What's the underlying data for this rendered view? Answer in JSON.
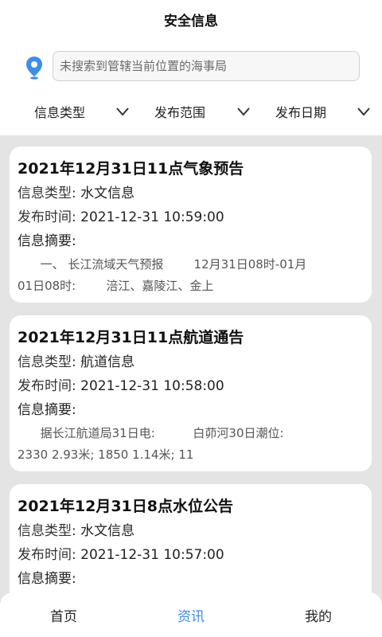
{
  "header": {
    "title": "安全信息"
  },
  "search": {
    "placeholder": "未搜索到管辖当前位置的海事局"
  },
  "colors": {
    "accent": "#3b8eea",
    "list_bg": "#e4e4e4"
  },
  "filters": [
    {
      "label": "信息类型"
    },
    {
      "label": "发布范围"
    },
    {
      "label": "发布日期"
    }
  ],
  "labels": {
    "type": "信息类型:",
    "time": "发布时间:",
    "summary": "信息摘要:"
  },
  "cards": [
    {
      "title": "2021年12月31日11点气象预告",
      "type": "水文信息",
      "time": "2021-12-31 10:59:00",
      "summary_line1": "      一、 长江流域天气预报        12月31日08时-01月",
      "summary_line2": "01日08时:        涪江、嘉陵江、金上"
    },
    {
      "title": "2021年12月31日11点航道通告",
      "type": "航道信息",
      "time": "2021-12-31 10:58:00",
      "summary_line1": "      据长江航道局31日电:          白茆河30日潮位:",
      "summary_line2": "2330 2.93米; 1850 1.14米; 11"
    },
    {
      "title": "2021年12月31日8点水位公告",
      "type": "水文信息",
      "time": "2021-12-31 10:57:00",
      "summary_line1": "",
      "summary_line2": ""
    }
  ],
  "tabs": [
    {
      "label": "首页",
      "active": false
    },
    {
      "label": "资讯",
      "active": true
    },
    {
      "label": "我的",
      "active": false
    }
  ]
}
